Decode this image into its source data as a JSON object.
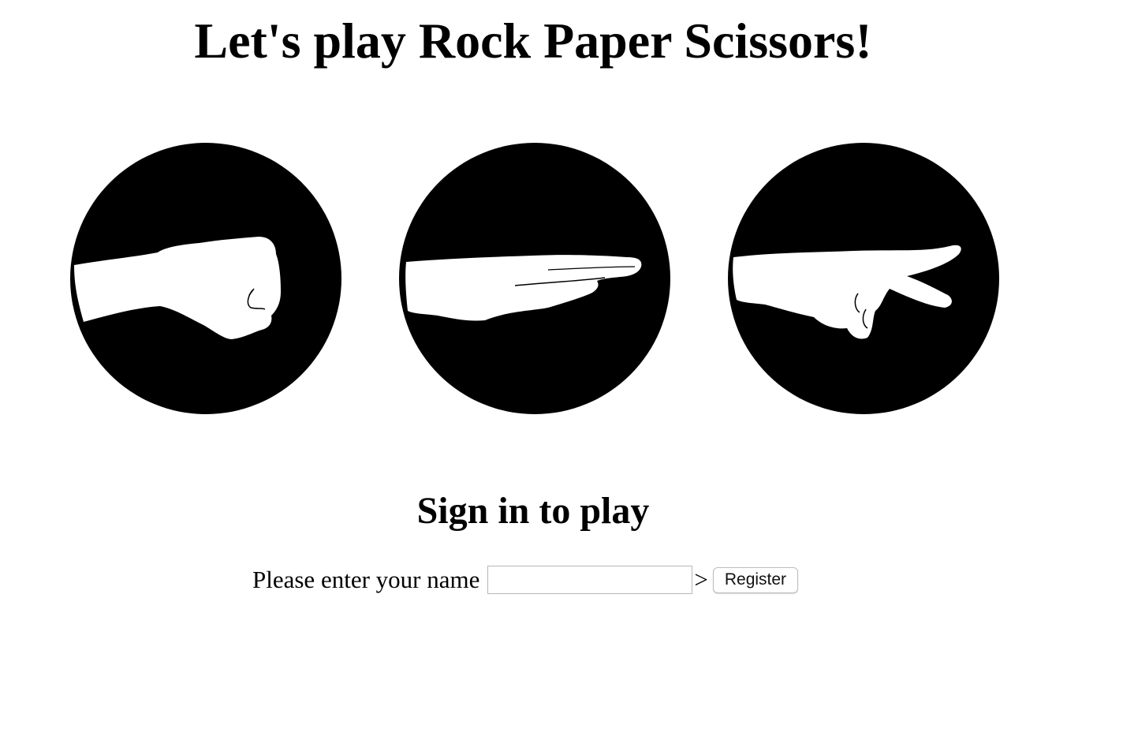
{
  "header": {
    "title": "Let's play Rock Paper Scissors!"
  },
  "choices": [
    {
      "name": "rock",
      "icon": "rock-fist-icon"
    },
    {
      "name": "paper",
      "icon": "paper-flat-hand-icon"
    },
    {
      "name": "scissors",
      "icon": "scissors-two-fingers-icon"
    }
  ],
  "signin": {
    "heading": "Sign in to play",
    "prompt": "Please enter your name",
    "name_value": "",
    "separator": ">",
    "register_label": "Register"
  },
  "colors": {
    "circle": "#000000",
    "hand": "#ffffff",
    "background": "#ffffff"
  }
}
